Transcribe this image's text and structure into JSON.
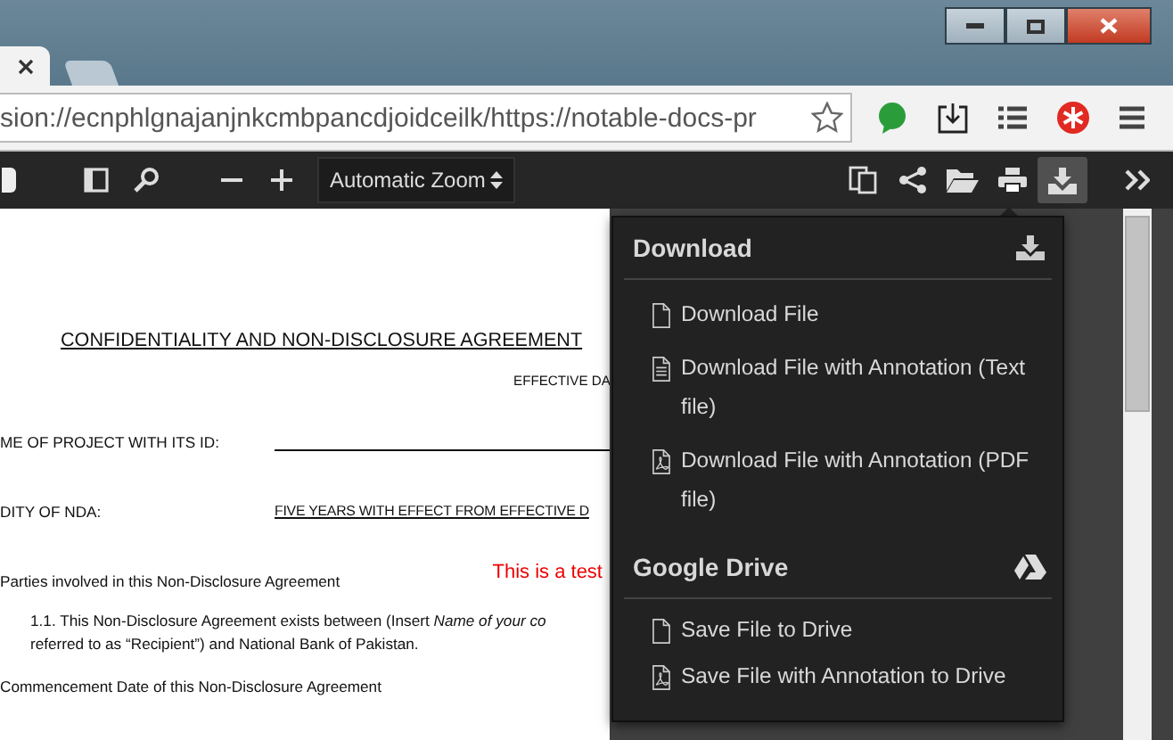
{
  "tabs": [
    {
      "selected": true
    },
    {
      "selected": false
    }
  ],
  "address_bar": {
    "value": "sion://ecnphlgnajanjnkcmbpancdjoidceilk/https://notable-docs-pr"
  },
  "pdf_toolbar": {
    "zoom": "Automatic Zoom",
    "download_pressed": true
  },
  "document": {
    "lines": [
      {
        "kind": "title",
        "text": "CONFIDENTIALITY AND NON-DISCLOSURE AGREEMENT"
      },
      {
        "kind": "right",
        "text": "EFFECTIVE DA"
      },
      {
        "kind": "blank_field",
        "label": "ME OF PROJECT WITH ITS ID:"
      },
      {
        "kind": "field",
        "label": "DITY OF NDA:",
        "value": "FIVE YEARS WITH EFFECT FROM EFFECTIVE D"
      },
      {
        "kind": "heading",
        "text": "Parties involved in this Non-Disclosure Agreement",
        "note": "This is a test"
      },
      {
        "kind": "para",
        "text": "1.1. This Non-Disclosure Agreement exists between (Insert *Name of your co*"
      },
      {
        "kind": "para2",
        "text": "referred to as “Recipient”) and National Bank of Pakistan."
      },
      {
        "kind": "heading",
        "text": "Commencement Date of this Non-Disclosure Agreement"
      }
    ]
  },
  "menu": {
    "sections": [
      {
        "title": "Download",
        "kind": "download",
        "items": [
          {
            "label": "Download File",
            "kind": "file"
          },
          {
            "label": "Download File with Annotation (Text file)",
            "kind": "text"
          },
          {
            "label": "Download File with Annotation (PDF file)",
            "kind": "pdf"
          }
        ]
      },
      {
        "title": "Google Drive",
        "kind": "drive",
        "items": [
          {
            "label": "Save File to Drive",
            "kind": "file"
          },
          {
            "label": "Save File with Annotation to Drive",
            "kind": "pdf"
          }
        ]
      }
    ]
  }
}
